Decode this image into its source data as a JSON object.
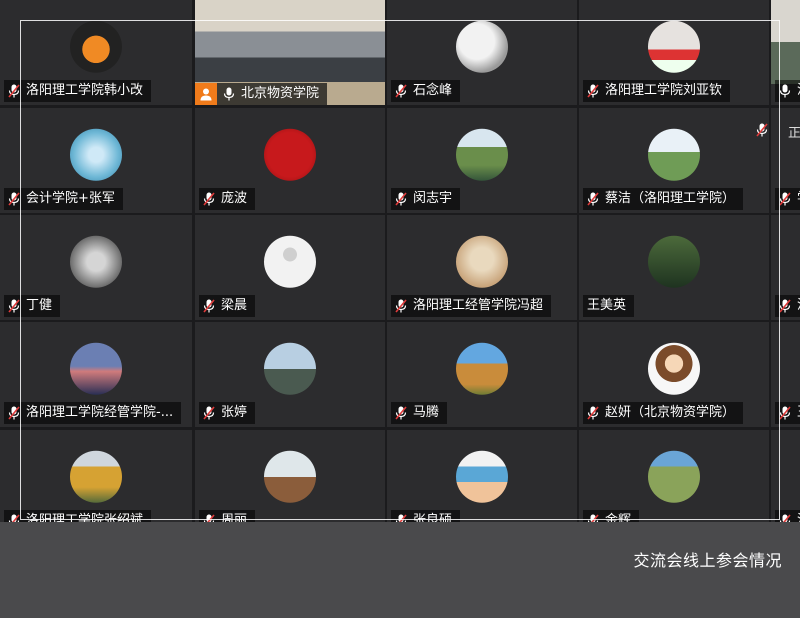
{
  "caption": "交流会线上参会情况",
  "participants": [
    {
      "name": "洛阳理工学院韩小改"
    },
    {
      "name": "北京物资学院"
    },
    {
      "name": "石念峰"
    },
    {
      "name": "洛阳理工学院刘亚钦"
    },
    {
      "name": "洛"
    },
    {
      "name": "会计学院+张军"
    },
    {
      "name": "庞波"
    },
    {
      "name": "闵志宇"
    },
    {
      "name": "蔡洁（洛阳理工学院）"
    },
    {
      "name": "学"
    },
    {
      "name": "丁健"
    },
    {
      "name": "梁晨"
    },
    {
      "name": "洛阳理工经管学院冯超"
    },
    {
      "name": "王美英"
    },
    {
      "name": "洛"
    },
    {
      "name": "洛阳理工学院经管学院-..."
    },
    {
      "name": "张婷"
    },
    {
      "name": "马腾"
    },
    {
      "name": "赵妍（北京物资学院）"
    },
    {
      "name": "王"
    },
    {
      "name": "洛阳理工学院张绍斌"
    },
    {
      "name": "周丽"
    },
    {
      "name": "张良硕"
    },
    {
      "name": "金辉"
    },
    {
      "name": "洛"
    }
  ],
  "partial_label": "正",
  "colors": {
    "accent": "#f07b1b",
    "muted": "#e03b3b"
  }
}
